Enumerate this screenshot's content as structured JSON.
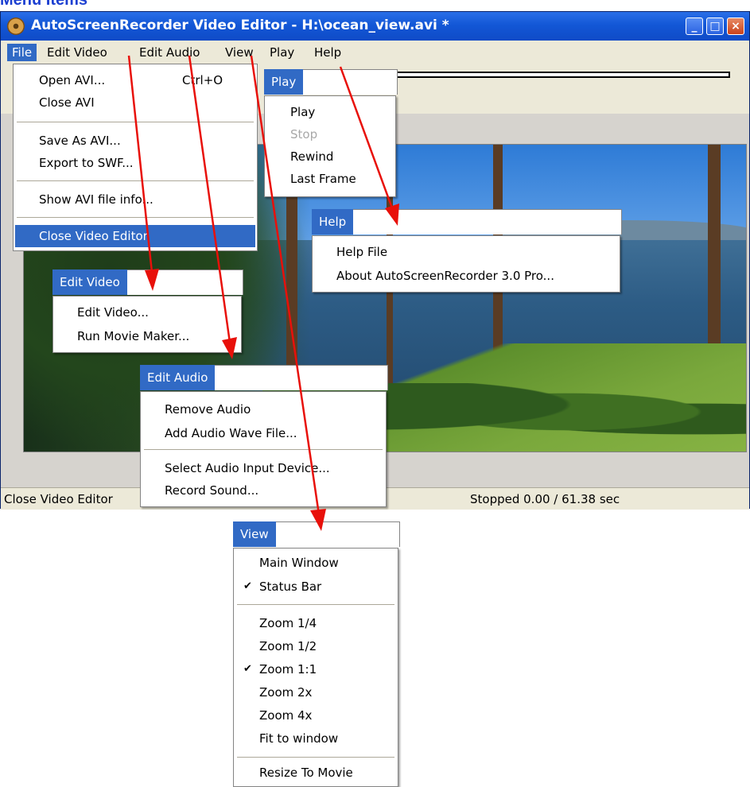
{
  "page_heading": "Menu Items",
  "window": {
    "title": "AutoScreenRecorder Video Editor - H:\\ocean_view.avi *",
    "buttons": {
      "minimize": "_",
      "maximize": "□",
      "close": "×"
    }
  },
  "menubar": {
    "items": [
      {
        "label": "File"
      },
      {
        "label": "Edit Video"
      },
      {
        "label": "Edit Audio"
      },
      {
        "label": "View"
      },
      {
        "label": "Play"
      },
      {
        "label": "Help"
      }
    ]
  },
  "file_menu": {
    "items": [
      {
        "label": "Open AVI...",
        "shortcut": "Ctrl+O"
      },
      {
        "label": "Close AVI"
      },
      {
        "label": "Save As AVI..."
      },
      {
        "label": "Export to SWF..."
      },
      {
        "label": "Show AVI file info..."
      },
      {
        "label": "Close Video Editor"
      }
    ]
  },
  "play_menu": {
    "header": "Play",
    "items": [
      {
        "label": "Play"
      },
      {
        "label": "Stop"
      },
      {
        "label": "Rewind"
      },
      {
        "label": "Last Frame"
      }
    ]
  },
  "help_menu": {
    "header": "Help",
    "items": [
      {
        "label": "Help File"
      },
      {
        "label": "About AutoScreenRecorder 3.0 Pro..."
      }
    ]
  },
  "edit_video_menu": {
    "header": "Edit Video",
    "items": [
      {
        "label": "Edit Video..."
      },
      {
        "label": "Run Movie Maker..."
      }
    ]
  },
  "edit_audio_menu": {
    "header": "Edit Audio",
    "items": [
      {
        "label": "Remove Audio"
      },
      {
        "label": "Add Audio Wave File..."
      },
      {
        "label": "Select Audio Input Device..."
      },
      {
        "label": "Record Sound..."
      }
    ]
  },
  "view_menu": {
    "header": "View",
    "items": [
      {
        "label": "Main Window"
      },
      {
        "label": "Status Bar",
        "checked": true
      },
      {
        "label": "Zoom 1/4"
      },
      {
        "label": "Zoom 1/2"
      },
      {
        "label": "Zoom 1:1",
        "checked": true
      },
      {
        "label": "Zoom 2x"
      },
      {
        "label": "Zoom 4x"
      },
      {
        "label": "Fit to window"
      },
      {
        "label": "Resize To Movie"
      }
    ]
  },
  "statusbar": {
    "left": "Close Video Editor",
    "right": "Stopped   0.00 / 61.38 sec"
  },
  "check_mark": "✔",
  "colors": {
    "highlight": "#316ac5",
    "arrow": "#e8100a",
    "heading": "#1c3fd1"
  }
}
